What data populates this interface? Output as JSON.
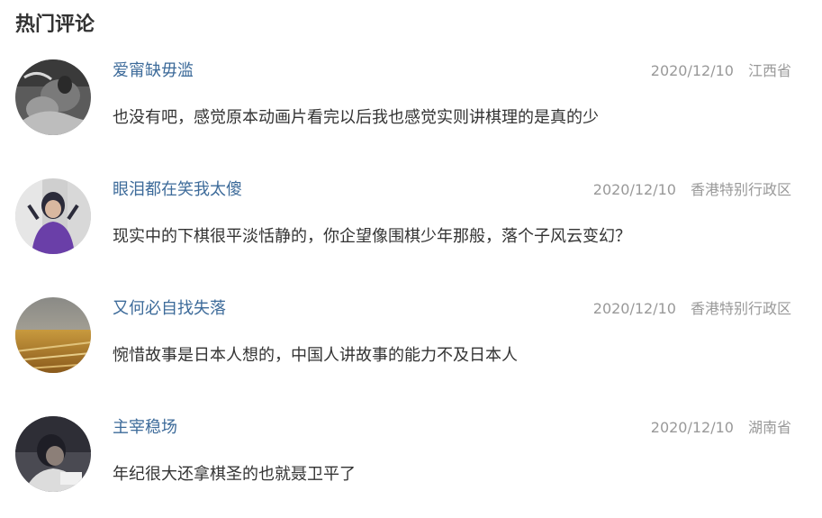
{
  "section": {
    "title": "热门评论"
  },
  "comments": [
    {
      "username": "爱甯缺毋滥",
      "date": "2020/12/10",
      "location": "江西省",
      "content": "也没有吧，感觉原本动画片看完以后我也感觉实则讲棋理的是真的少",
      "avatar": "avatar-photo-dark-figure"
    },
    {
      "username": "眼泪都在笑我太傻",
      "date": "2020/12/10",
      "location": "香港特别行政区",
      "content": "现实中的下棋很平淡恬静的，你企望像围棋少年那般，落个子风云变幻？",
      "avatar": "avatar-photo-girl-purple"
    },
    {
      "username": "又何必自找失落",
      "date": "2020/12/10",
      "location": "香港特别行政区",
      "content": "惋惜故事是日本人想的，中国人讲故事的能力不及日本人",
      "avatar": "avatar-photo-wheat-field"
    },
    {
      "username": "主宰稳场",
      "date": "2020/12/10",
      "location": "湖南省",
      "content": "年纪很大还拿棋圣的也就聂卫平了",
      "avatar": "avatar-photo-dark-person"
    }
  ],
  "colors": {
    "username": "#3d6b9a",
    "meta": "#999999",
    "text": "#333333"
  }
}
